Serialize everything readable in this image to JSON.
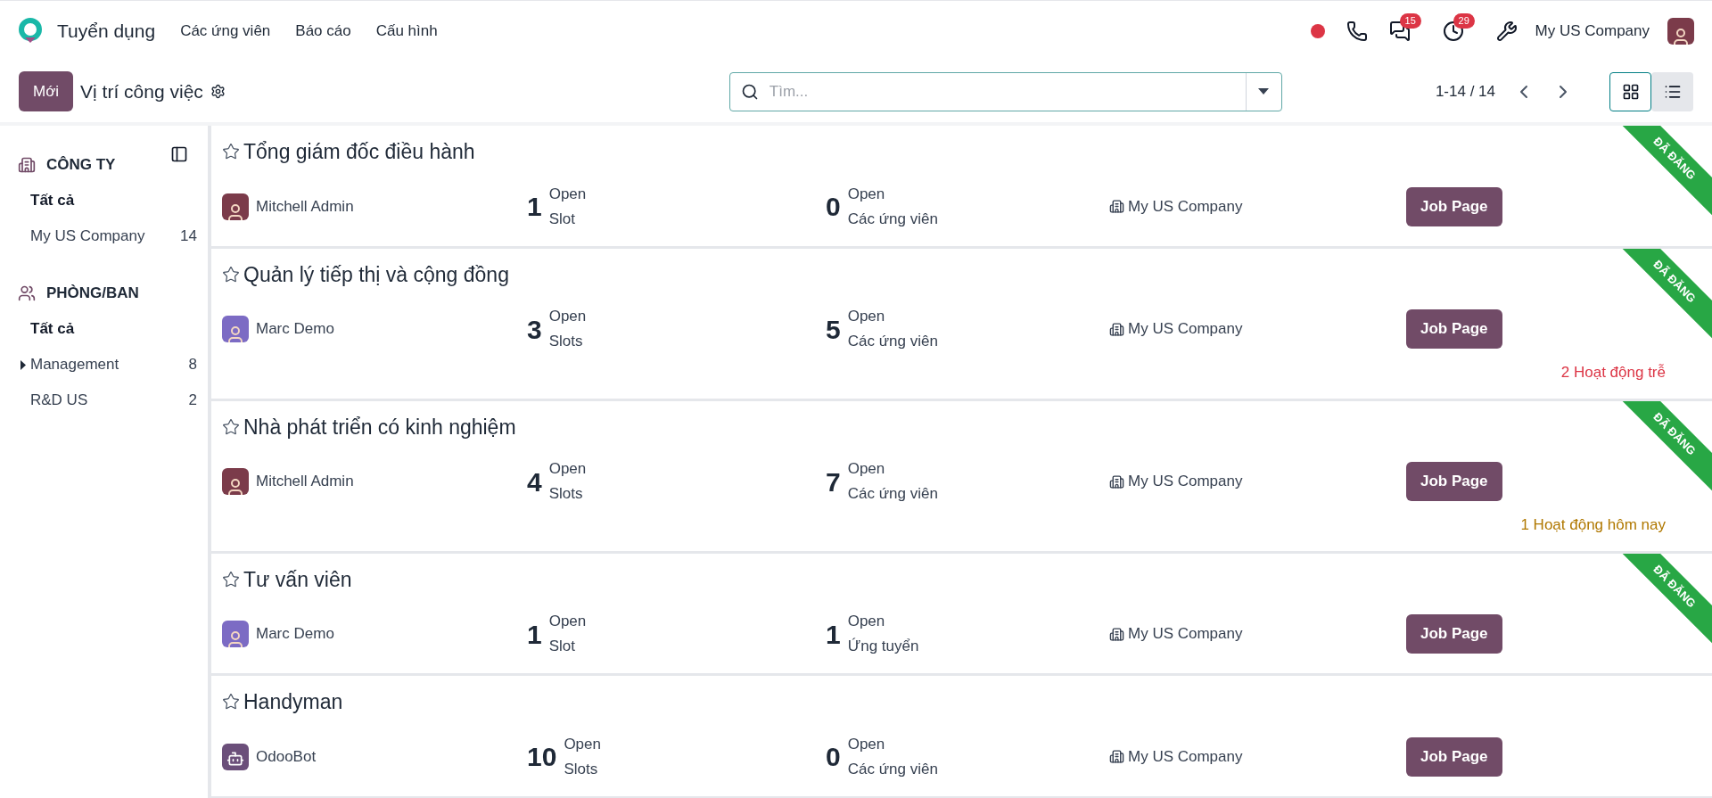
{
  "app": {
    "name": "Tuyển dụng",
    "menu": [
      "Các ứng viên",
      "Báo cáo",
      "Cấu hình"
    ]
  },
  "systray": {
    "chat_count": "15",
    "activity_count": "29",
    "company": "My US Company"
  },
  "control": {
    "new_button": "Mới",
    "breadcrumb": "Vị trí công việc",
    "search": {
      "placeholder": "Tìm..."
    },
    "pager": "1-14 / 14",
    "views": [
      {
        "kind": "kanban",
        "selected": true
      },
      {
        "kind": "list",
        "selected": false
      }
    ]
  },
  "sidebar": {
    "sections": [
      {
        "kind": "company",
        "title": "CÔNG TY",
        "items": [
          {
            "kind": "leaf",
            "label": "Tất cả",
            "selected": true
          },
          {
            "kind": "leaf",
            "label": "My US Company",
            "count": "14",
            "selected": false
          }
        ]
      },
      {
        "kind": "department",
        "title": "PHÒNG/BAN",
        "items": [
          {
            "kind": "leaf",
            "label": "Tất cả",
            "selected": true
          },
          {
            "kind": "folder",
            "label": "Management",
            "count": "8",
            "selected": false,
            "expanded": false
          },
          {
            "kind": "leaf",
            "label": "R&D US",
            "count": "2",
            "selected": false
          }
        ]
      }
    ]
  },
  "jobs": [
    {
      "title": "Tổng giám đốc điều hành",
      "starred": false,
      "published": true,
      "ribbon": "ĐÃ ĐĂNG",
      "owner": "Mitchell Admin",
      "avatar": {
        "kind": "person",
        "color": "#7b3b4a"
      },
      "slots": "1",
      "slots_label_1": "Open",
      "slots_label_2": "Slot",
      "applicants": "0",
      "applicants_label_1": "Open",
      "applicants_label_2": "Các ứng viên",
      "company": "My US Company",
      "button": "Job Page"
    },
    {
      "title": "Quản lý tiếp thị và cộng đồng",
      "starred": false,
      "published": true,
      "ribbon": "ĐÃ ĐĂNG",
      "owner": "Marc Demo",
      "avatar": {
        "kind": "person",
        "color": "#7c6bc4"
      },
      "slots": "3",
      "slots_label_1": "Open",
      "slots_label_2": "Slots",
      "applicants": "5",
      "applicants_label_1": "Open",
      "applicants_label_2": "Các ứng viên",
      "company": "My US Company",
      "button": "Job Page",
      "activity": {
        "kind": "late",
        "text": "2 Hoạt động trễ"
      }
    },
    {
      "title": "Nhà phát triển có kinh nghiệm",
      "starred": false,
      "published": true,
      "ribbon": "ĐÃ ĐĂNG",
      "owner": "Mitchell Admin",
      "avatar": {
        "kind": "person",
        "color": "#7b3b4a"
      },
      "slots": "4",
      "slots_label_1": "Open",
      "slots_label_2": "Slots",
      "applicants": "7",
      "applicants_label_1": "Open",
      "applicants_label_2": "Các ứng viên",
      "company": "My US Company",
      "button": "Job Page",
      "activity": {
        "kind": "today",
        "text": "1 Hoạt động hôm nay"
      }
    },
    {
      "title": "Tư vấn viên",
      "starred": false,
      "published": true,
      "ribbon": "ĐÃ ĐĂNG",
      "owner": "Marc Demo",
      "avatar": {
        "kind": "person",
        "color": "#7c6bc4"
      },
      "slots": "1",
      "slots_label_1": "Open",
      "slots_label_2": "Slot",
      "applicants": "1",
      "applicants_label_1": "Open",
      "applicants_label_2": "Ứng tuyển",
      "company": "My US Company",
      "button": "Job Page"
    },
    {
      "title": "Handyman",
      "starred": false,
      "published": false,
      "owner": "OdooBot",
      "avatar": {
        "kind": "bot",
        "color": "#6b4f7a"
      },
      "slots": "10",
      "slots_label_1": "Open",
      "slots_label_2": "Slots",
      "applicants": "0",
      "applicants_label_1": "Open",
      "applicants_label_2": "Các ứng viên",
      "company": "My US Company",
      "button": "Job Page"
    }
  ]
}
